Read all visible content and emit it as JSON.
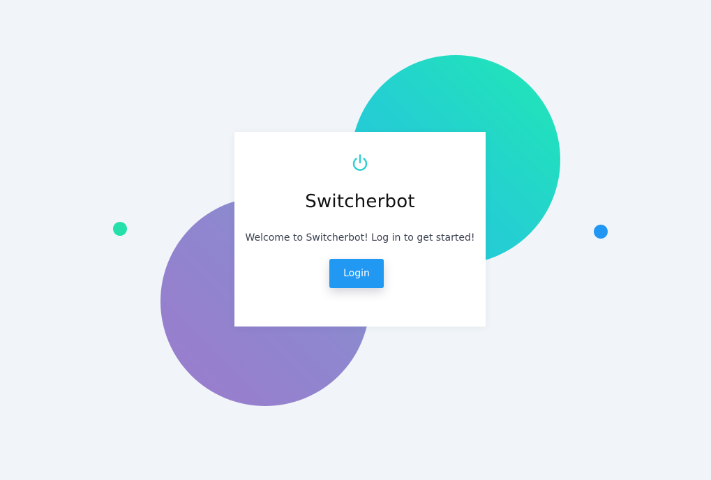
{
  "app": {
    "title": "Switcherbot",
    "welcome_text": "Welcome to Switcherbot! Log in to get started!",
    "login_label": "Login",
    "icon": "power-icon"
  },
  "colors": {
    "background": "#f1f5f9",
    "accent_teal": "#24cfd2",
    "accent_purple": "#9085cf",
    "dot_green": "#25e0aa",
    "dot_blue": "#2196f3",
    "button": "#2199f3"
  }
}
